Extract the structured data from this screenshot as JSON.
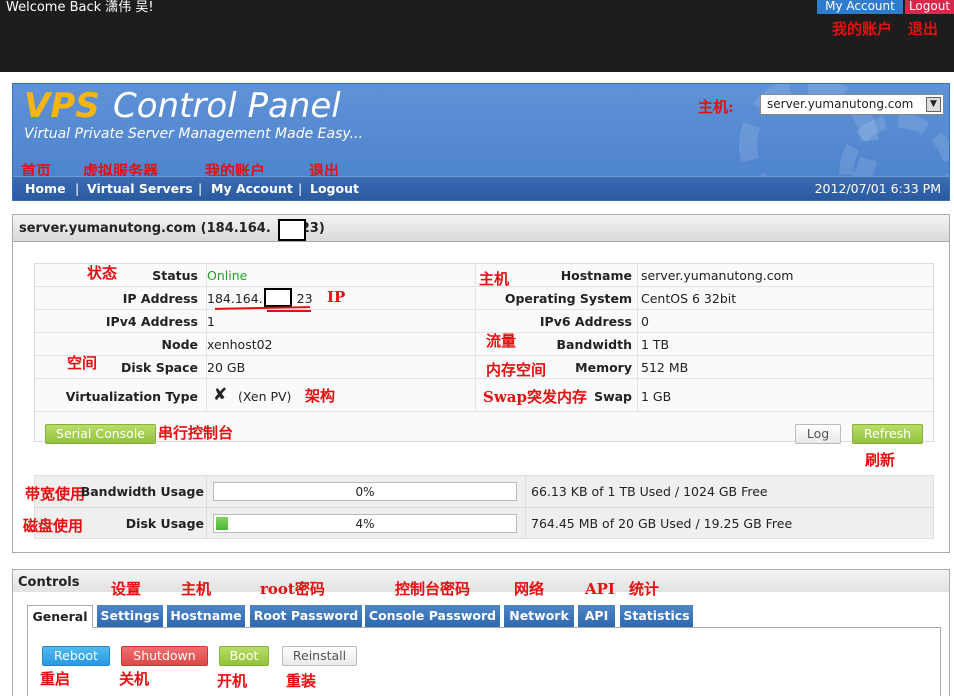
{
  "topbar": {
    "welcome": "Welcome Back 潇伟 吴!",
    "my_account": "My Account",
    "logout": "Logout"
  },
  "header": {
    "logo_vps": "VPS",
    "logo_rest": "Control Panel",
    "tagline": "Virtual Private Server Management Made Easy...",
    "server_select": "server.yumanutong.com",
    "nav": [
      "Home",
      "Virtual Servers",
      "My Account",
      "Logout"
    ],
    "datetime": "2012/07/01 6:33 PM"
  },
  "server_panel": {
    "title": "server.yumanutong.com (184.164.",
    "title_suffix": "23)",
    "left": {
      "status_label": "Status",
      "status": "Online",
      "ip_label": "IP Address",
      "ip_prefix": "184.164.",
      "ip_suffix": "23",
      "ipv4_label": "IPv4 Address",
      "ipv4": "1",
      "node_label": "Node",
      "node": "xenhost02",
      "disk_label": "Disk Space",
      "disk": "20 GB",
      "virt_label": "Virtualization Type",
      "virt": "(Xen PV)"
    },
    "right": {
      "hostname_label": "Hostname",
      "hostname": "server.yumanutong.com",
      "os_label": "Operating System",
      "os": "CentOS 6 32bit",
      "ipv6_label": "IPv6 Address",
      "ipv6": "0",
      "bw_label": "Bandwidth",
      "bw": "1 TB",
      "mem_label": "Memory",
      "mem": "512 MB",
      "swap_label": "Swap",
      "swap": "1 GB"
    },
    "buttons": {
      "serial": "Serial Console",
      "log": "Log",
      "refresh": "Refresh"
    },
    "usage": {
      "bw_label": "Bandwidth Usage",
      "bw_pct": "0%",
      "bw_pct_value": 0,
      "bw_text": "66.13 KB of 1 TB Used / 1024 GB Free",
      "disk_label": "Disk Usage",
      "disk_pct": "4%",
      "disk_pct_value": 4,
      "disk_text": "764.45 MB of 20 GB Used / 19.25 GB Free"
    }
  },
  "controls": {
    "title": "Controls",
    "tabs": [
      "General",
      "Settings",
      "Hostname",
      "Root Password",
      "Console Password",
      "Network",
      "API",
      "Statistics"
    ],
    "buttons": {
      "reboot": "Reboot",
      "shutdown": "Shutdown",
      "boot": "Boot",
      "reinstall": "Reinstall"
    }
  },
  "annotations": {
    "my_account": "我的账户",
    "logout": "退出",
    "host": "主机:",
    "nav_home": "首页",
    "nav_vs": "虚拟服务器",
    "nav_acct": "我的账户",
    "nav_logout": "退出",
    "status": "状态",
    "ip": "IP",
    "space": "空间",
    "arch": "架构",
    "serial": "串行控制台",
    "hostname": "主机",
    "bandwidth": "流量",
    "memory": "内存空间",
    "swap": "Swap突发内存",
    "refresh": "刷新",
    "bw_usage": "带宽使用",
    "disk_usage": "磁盘使用",
    "tab_settings": "设置",
    "tab_hostname": "主机",
    "tab_rootpw": "root密码",
    "tab_consolepw": "控制台密码",
    "tab_network": "网络",
    "tab_api": "API",
    "tab_stats": "统计",
    "reboot": "重启",
    "shutdown": "关机",
    "boot": "开机",
    "reinstall": "重装"
  },
  "colors": {
    "accent_blue": "#4a80cc",
    "logo_orange": "#f7b512",
    "online": "#22a022",
    "annotation_red": "#e41010"
  }
}
